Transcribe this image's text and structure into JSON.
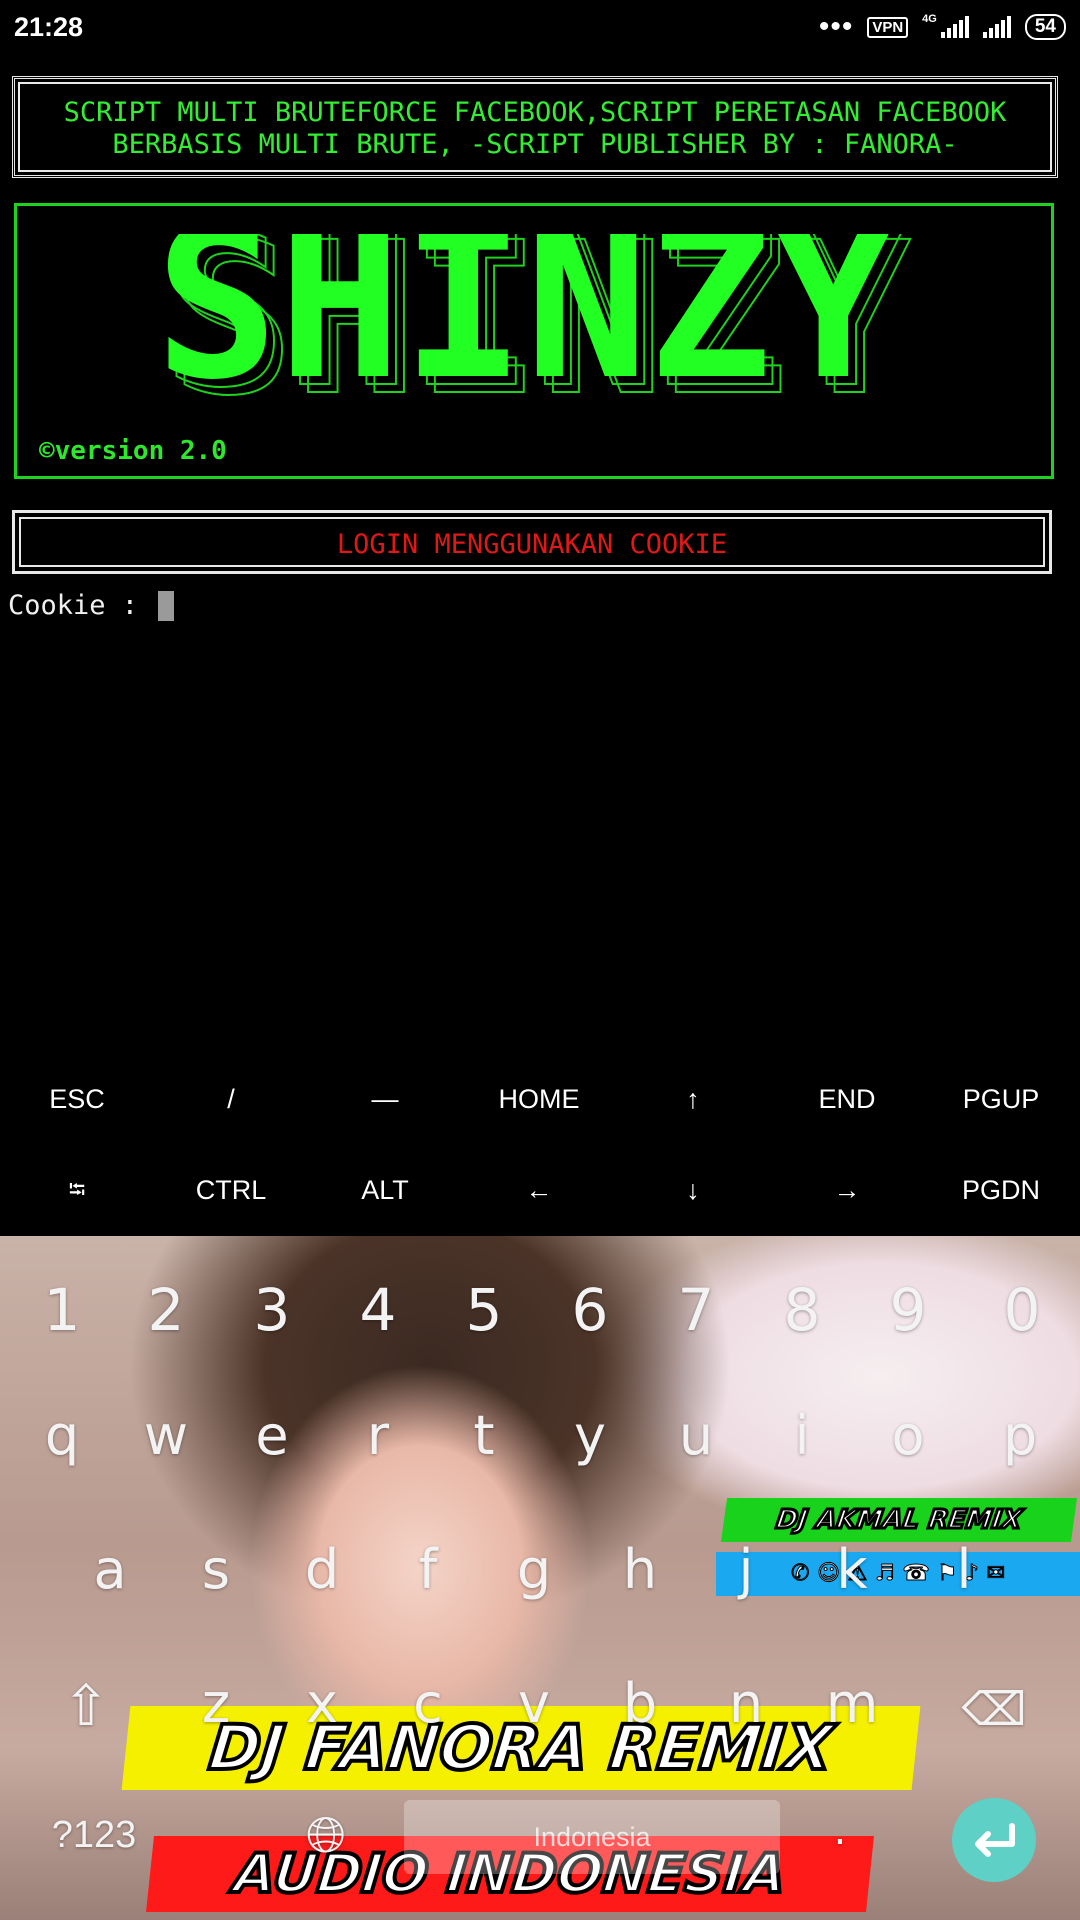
{
  "status_bar": {
    "time": "21:28",
    "vpn": "VPN",
    "network": "4G",
    "battery": "54"
  },
  "banner": {
    "line1": "SCRIPT MULTI BRUTEFORCE FACEBOOK,SCRIPT PERETASAN FACEBOOK",
    "line2": "BERBASIS MULTI BRUTE, -SCRIPT PUBLISHER BY : FANORA-"
  },
  "logo": {
    "title": "SHINZY",
    "version": "©version 2.0"
  },
  "login": {
    "header": "LOGIN MENGGUNAKAN COOKIE",
    "prompt": "Cookie : "
  },
  "extra_keys": {
    "row1": [
      "ESC",
      "/",
      "—",
      "HOME",
      "↑",
      "END",
      "PGUP"
    ],
    "row2": [
      "⭾",
      "CTRL",
      "ALT",
      "←",
      "↓",
      "→",
      "PGDN"
    ]
  },
  "keyboard": {
    "numbers": [
      "1",
      "2",
      "3",
      "4",
      "5",
      "6",
      "7",
      "8",
      "9",
      "0"
    ],
    "row1": [
      "q",
      "w",
      "e",
      "r",
      "t",
      "y",
      "u",
      "i",
      "o",
      "p"
    ],
    "row2": [
      "a",
      "s",
      "d",
      "f",
      "g",
      "h",
      "j",
      "k",
      "l"
    ],
    "row3": [
      "z",
      "x",
      "c",
      "v",
      "b",
      "n",
      "m"
    ],
    "symbols_key": "?123",
    "space_label": "Indonesia",
    "period": "."
  },
  "wallpaper_text": {
    "sticker1": "DJ AKMAL REMIX",
    "sticker2": "DJ FANORA REMIX",
    "sticker3": "AUDIO INDONESIA"
  },
  "colors": {
    "terminal_green": "#22ee22",
    "login_red": "#e01818",
    "enter_key": "#5fd0c6"
  }
}
